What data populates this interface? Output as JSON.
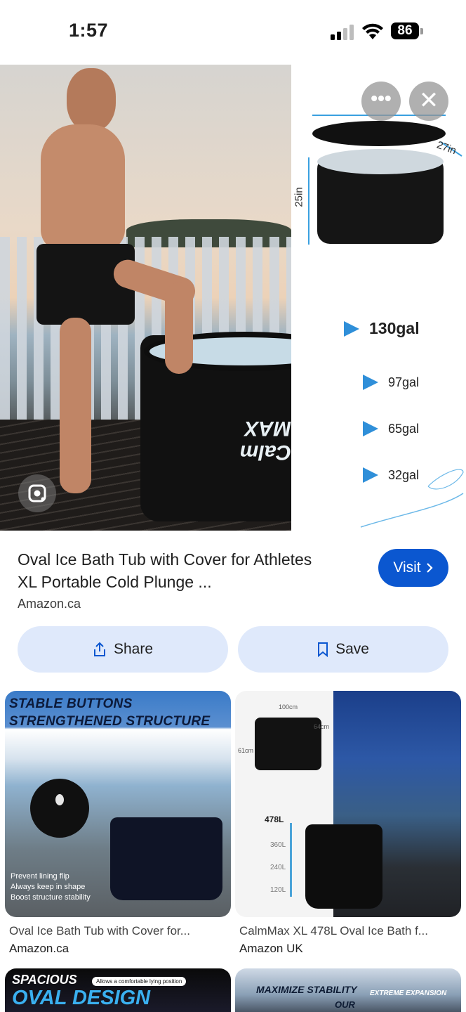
{
  "status_bar": {
    "time": "1:57",
    "battery": "86"
  },
  "hero": {
    "tub_logo": "Calm MAX",
    "spec": {
      "width_label": "27in",
      "height_label": "25in"
    },
    "volumes": [
      "130gal",
      "97gal",
      "65gal",
      "32gal"
    ]
  },
  "result": {
    "title_line1": "Oval Ice Bath Tub with Cover for Athletes",
    "title_line2": "XL Portable Cold Plunge ...",
    "source": "Amazon.ca",
    "visit_label": "Visit",
    "share_label": "Share",
    "save_label": "Save"
  },
  "related": [
    {
      "banner_line1": "STABLE BUTTONS",
      "banner_line2": "STRENGTHENED STRUCTURE",
      "features": [
        "Prevent lining flip",
        "Always keep in shape",
        "Boost structure stability"
      ],
      "title": "Oval Ice Bath Tub with Cover for...",
      "source": "Amazon.ca"
    },
    {
      "dims": [
        "100cm",
        "64cm",
        "61cm"
      ],
      "scale": [
        "478L",
        "360L",
        "240L",
        "120L"
      ],
      "title": "CalmMax XL 478L Oval Ice Bath f...",
      "source": "Amazon UK"
    },
    {
      "line1": "SPACIOUS",
      "line2": "OVAL DESIGN",
      "pill": "Allows a comfortable lying position"
    },
    {
      "line1": "MAXIMIZE STABILITY",
      "line2": "EXTREME EXPANSION",
      "line3": "OUR"
    }
  ],
  "colors": {
    "accent": "#0b57d0",
    "button_bg": "#dfe9fb",
    "volume_arrow": "#2f8fd9"
  }
}
